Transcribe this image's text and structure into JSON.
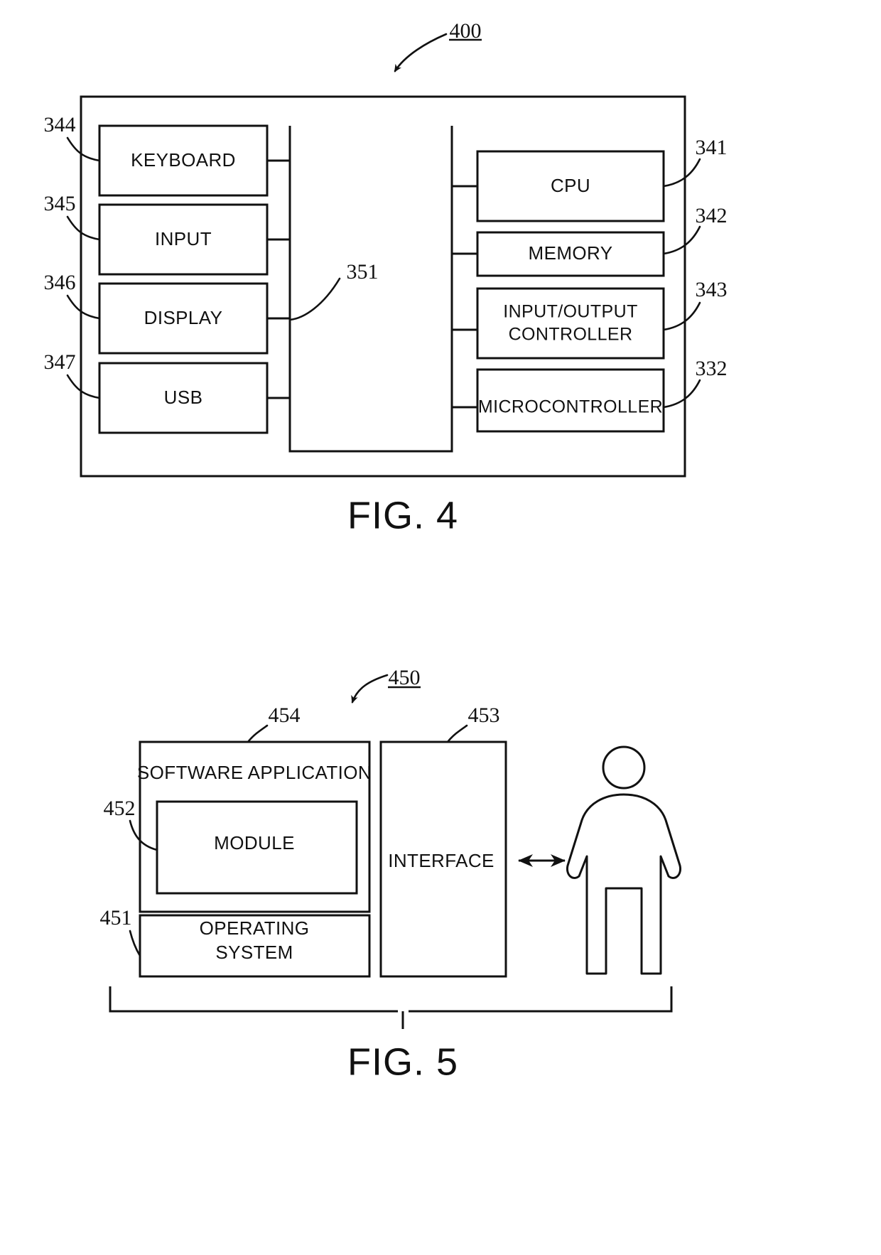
{
  "figures": [
    {
      "id": "fig4",
      "title": "FIG. 4",
      "system_ref": "400",
      "bus_ref": "351",
      "left_components": [
        {
          "label": "KEYBOARD",
          "ref": "344"
        },
        {
          "label": "INPUT",
          "ref": "345"
        },
        {
          "label": "DISPLAY",
          "ref": "346"
        },
        {
          "label": "USB",
          "ref": "347"
        }
      ],
      "right_components": [
        {
          "label": "CPU",
          "ref": "341"
        },
        {
          "label": "MEMORY",
          "ref": "342"
        },
        {
          "label": "INPUT/OUTPUT CONTROLLER",
          "label_line1": "INPUT/OUTPUT",
          "label_line2": "CONTROLLER",
          "ref": "343"
        },
        {
          "label": "MICROCONTROLLER",
          "ref": "332"
        }
      ]
    },
    {
      "id": "fig5",
      "title": "FIG. 5",
      "system_ref": "450",
      "blocks": [
        {
          "label": "SOFTWARE APPLICATION",
          "ref": "454"
        },
        {
          "label": "MODULE",
          "ref": "452"
        },
        {
          "label": "OPERATING SYSTEM",
          "label_line1": "OPERATING",
          "label_line2": "SYSTEM",
          "ref": "451"
        },
        {
          "label": "INTERFACE",
          "ref": "453"
        }
      ],
      "actor": "user-figure",
      "connector": "double-headed-arrow"
    }
  ],
  "colors": {
    "ink": "#111111",
    "paper": "#ffffff"
  }
}
